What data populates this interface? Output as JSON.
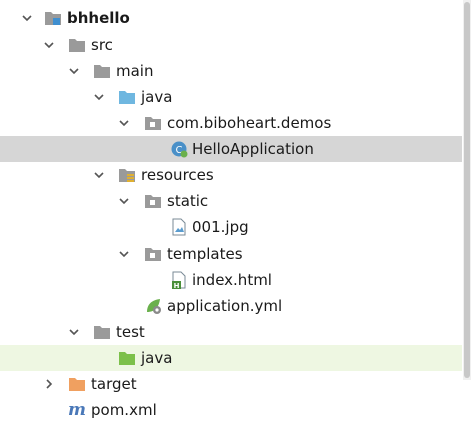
{
  "project_tree": {
    "items": [
      {
        "label": "bhhello",
        "icon": "module-folder-icon"
      },
      {
        "label": "src",
        "icon": "folder-icon"
      },
      {
        "label": "main",
        "icon": "folder-icon"
      },
      {
        "label": "java",
        "icon": "source-root-folder-icon"
      },
      {
        "label": "com.biboheart.demos",
        "icon": "package-icon"
      },
      {
        "label": "HelloApplication",
        "icon": "spring-boot-class-icon"
      },
      {
        "label": "resources",
        "icon": "resources-folder-icon"
      },
      {
        "label": "static",
        "icon": "package-icon"
      },
      {
        "label": "001.jpg",
        "icon": "image-file-icon"
      },
      {
        "label": "templates",
        "icon": "package-icon"
      },
      {
        "label": "index.html",
        "icon": "html-file-icon"
      },
      {
        "label": "application.yml",
        "icon": "spring-config-icon"
      },
      {
        "label": "test",
        "icon": "folder-icon"
      },
      {
        "label": "java",
        "icon": "test-source-root-folder-icon"
      },
      {
        "label": "target",
        "icon": "excluded-folder-icon"
      },
      {
        "label": "pom.xml",
        "icon": "maven-file-icon"
      }
    ]
  },
  "colors": {
    "selection": "#d6d6d6",
    "test_row_highlight": "#eef7e2",
    "source_root_blue": "#6fb7e0",
    "test_root_green": "#7cc04a",
    "excluded_orange": "#f0a060",
    "spring_green": "#6ab04c"
  }
}
